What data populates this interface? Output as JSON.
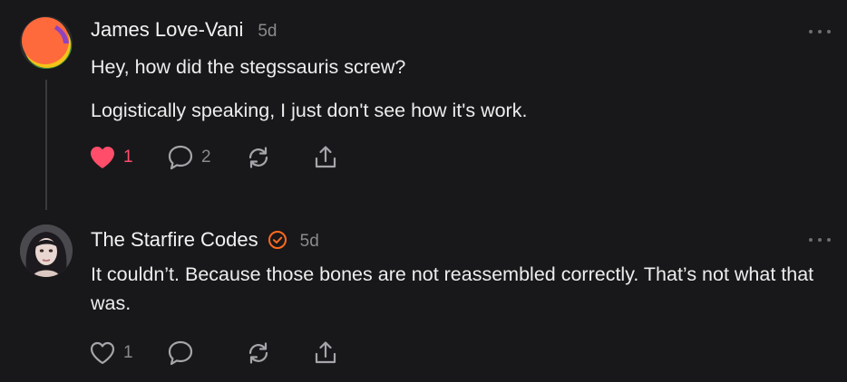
{
  "posts": [
    {
      "author": "James Love-Vani",
      "time": "5d",
      "verified": false,
      "avatar_icon": "abstract-circle-avatar",
      "paragraphs": [
        "Hey, how did the stegssauris screw?",
        "Logistically speaking, I just don't see how it's work."
      ],
      "likes": "1",
      "liked": true,
      "replies": "2"
    },
    {
      "author": "The Starfire Codes",
      "time": "5d",
      "verified": true,
      "avatar_icon": "profile-photo-avatar",
      "paragraphs": [
        "It couldn’t. Because those bones are not reassembled correctly. That’s not what that was."
      ],
      "likes": "1",
      "liked": false,
      "replies": ""
    }
  ],
  "colors": {
    "background": "#18181a",
    "like_active": "#ff4d6a",
    "verified_badge": "#ff6a1f",
    "muted": "#8a8a8e"
  }
}
